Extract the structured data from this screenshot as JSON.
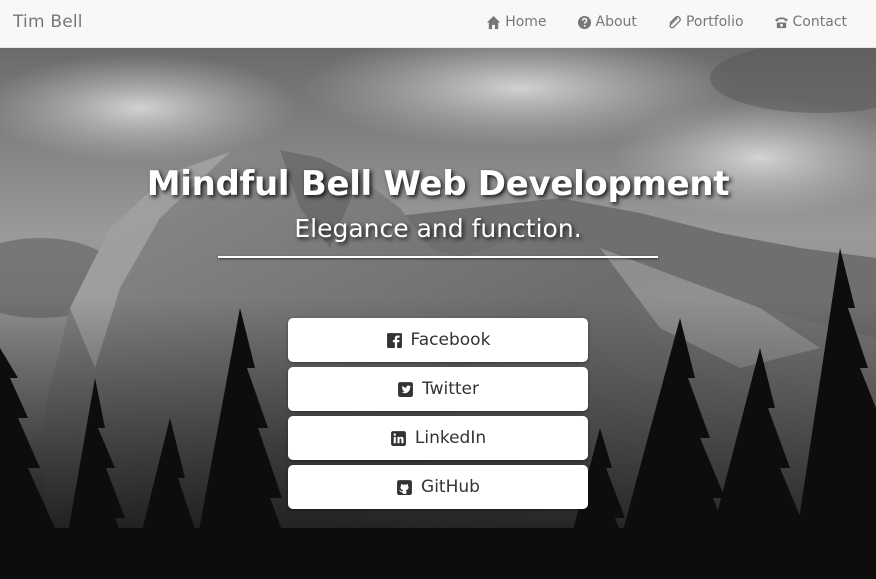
{
  "navbar": {
    "brand": "Tim Bell",
    "items": [
      {
        "label": "Home",
        "icon": "home-icon"
      },
      {
        "label": "About",
        "icon": "question-circle-icon"
      },
      {
        "label": "Portfolio",
        "icon": "paperclip-icon"
      },
      {
        "label": "Contact",
        "icon": "phone-icon"
      }
    ]
  },
  "hero": {
    "title": "Mindful Bell Web Development",
    "subtitle": "Elegance and function.",
    "social": [
      {
        "label": "Facebook",
        "icon": "facebook-square-icon"
      },
      {
        "label": "Twitter",
        "icon": "twitter-square-icon"
      },
      {
        "label": "LinkedIn",
        "icon": "linkedin-square-icon"
      },
      {
        "label": "GitHub",
        "icon": "github-square-icon"
      }
    ]
  },
  "colors": {
    "navbar_bg": "#f8f8f8",
    "nav_text": "#777777",
    "button_bg": "#ffffff",
    "button_text": "#333333"
  }
}
